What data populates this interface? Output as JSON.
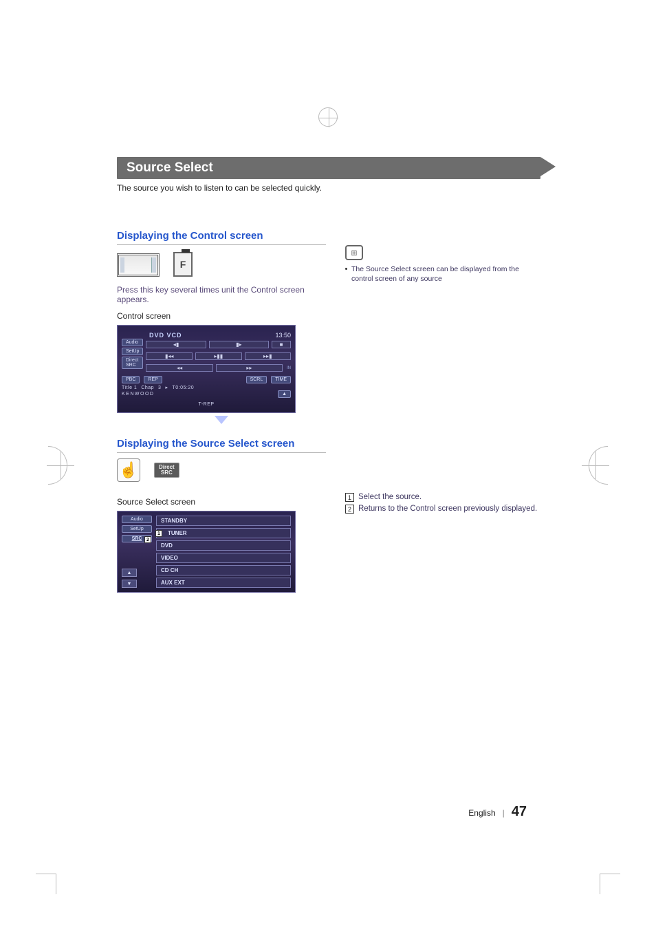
{
  "section_title": "Source Select",
  "intro": "The source you wish to listen to can be selected quickly.",
  "block1": {
    "heading": "Displaying the Control screen",
    "btn_f_label": "F",
    "press_text": "Press this key several times unit the Control screen appears.",
    "control_label": "Control screen",
    "screen": {
      "title": "DVD VCD",
      "clock": "13:50",
      "side": {
        "audio": "Audio",
        "setup": "SetUp",
        "direct": "Direct\nSRC"
      },
      "in_tag": "IN",
      "btns": {
        "prev_step": "◂▮",
        "next_step": "▮▸",
        "stop": "■",
        "prev": "▮◂◂",
        "playpause": "▸▮▮",
        "next": "▸▸▮",
        "rew": "◂◂",
        "ffwd": "▸▸"
      },
      "row4": {
        "pbc": "PBC",
        "rep": "REP",
        "scrl": "SCRL",
        "time": "TIME"
      },
      "status_title": "Title 1",
      "status_chap": "Chap",
      "status_num": "3",
      "status_play": "▸",
      "status_time": "T0:05:20",
      "brand": "KENWOOD",
      "eject": "▲",
      "trep": "T-REP"
    }
  },
  "block2": {
    "heading": "Displaying the Source Select screen",
    "direct_btn": "Direct\nSRC",
    "sss_label": "Source Select screen",
    "side": {
      "audio": "Audio",
      "setup": "SetUp",
      "src": "SRC"
    },
    "scroll_up": "▲",
    "scroll_down": "▼",
    "items": {
      "standby": "STANDBY",
      "tuner": "TUNER",
      "dvd": "DVD",
      "video": "VIDEO",
      "cdch": "CD CH",
      "auxext": "AUX EXT"
    },
    "badge1": "1",
    "badge2": "2"
  },
  "right1": {
    "note": "The Source Select screen can be displayed from the control screen of any source"
  },
  "right2": {
    "n1": "1",
    "t1": "Select the source.",
    "n2": "2",
    "t2": "Returns to the Control screen previously displayed."
  },
  "footer": {
    "lang": "English",
    "page": "47"
  }
}
